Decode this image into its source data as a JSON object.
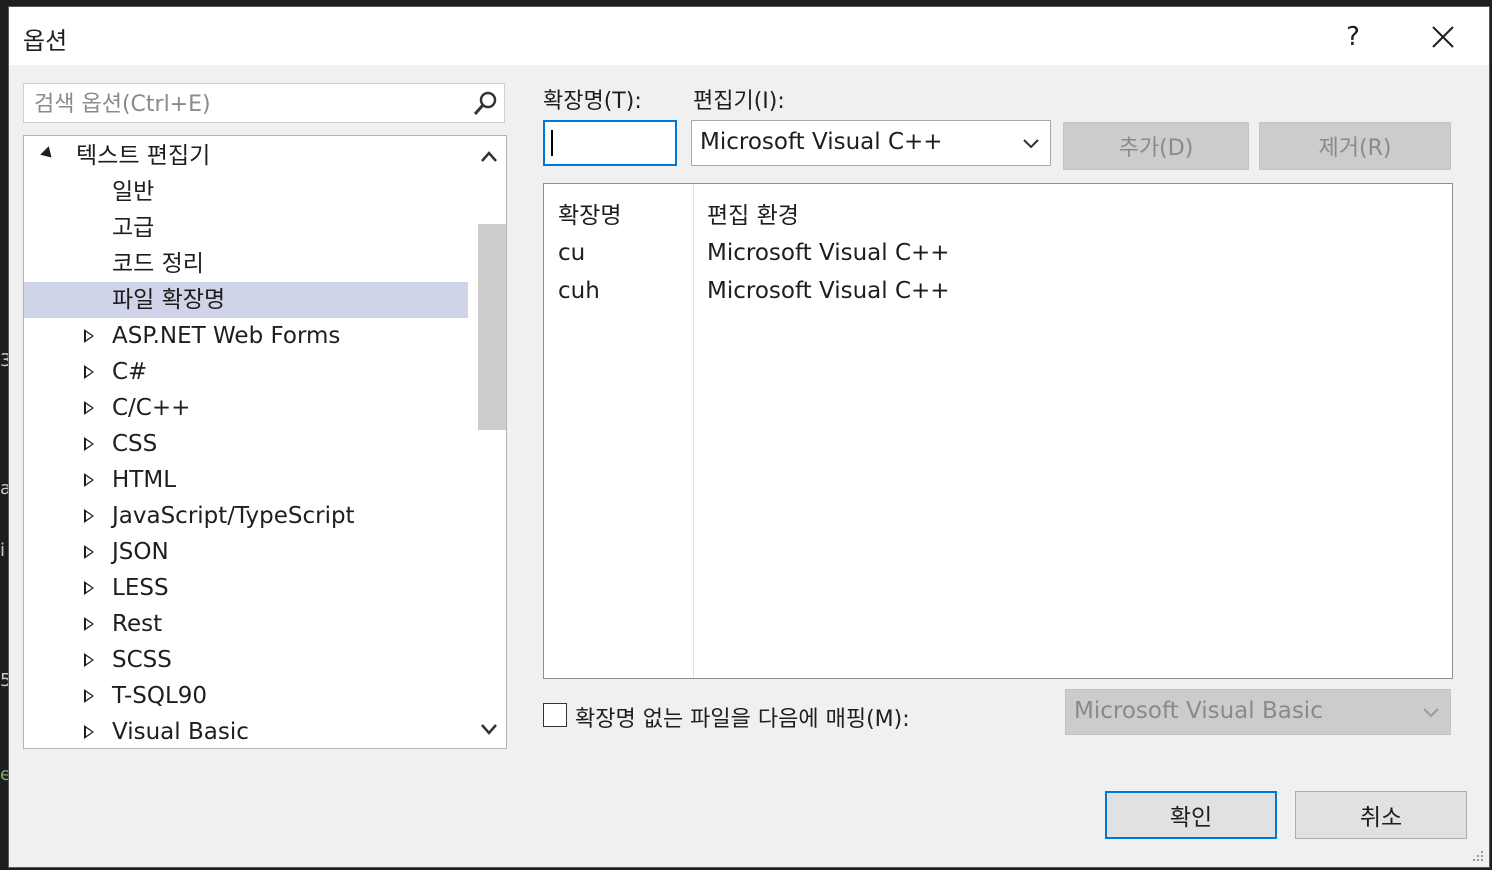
{
  "background_edge": {
    "glyphs": [
      "3",
      "a",
      "i",
      "5",
      "e"
    ]
  },
  "dialog": {
    "title": "옵션",
    "help_label": "?",
    "close_label": "✕"
  },
  "search": {
    "placeholder": "검색 옵션(Ctrl+E)"
  },
  "tree": {
    "expanded_label": "텍스트 편집기",
    "children": [
      "일반",
      "고급",
      "코드 정리",
      "파일 확장명"
    ],
    "selected": "파일 확장명",
    "collapsed_items": [
      "ASP.NET Web Forms",
      "C#",
      "C/C++",
      "CSS",
      "HTML",
      "JavaScript/TypeScript",
      "JSON",
      "LESS",
      "Rest",
      "SCSS",
      "T-SQL90",
      "Visual Basic"
    ]
  },
  "form": {
    "extension_label": "확장명(T):",
    "extension_value": "",
    "editor_label": "편집기(I):",
    "editor_value": "Microsoft Visual C++",
    "add_label": "추가(D)",
    "remove_label": "제거(R)"
  },
  "ext_table": {
    "headers": [
      "확장명",
      "편집 환경"
    ],
    "rows": [
      [
        "cu",
        "Microsoft Visual C++"
      ],
      [
        "cuh",
        "Microsoft Visual C++"
      ]
    ]
  },
  "mapping": {
    "checkbox_label": "확장명 없는 파일을 다음에 매핑(M):",
    "checked": false,
    "select_value": "Microsoft Visual Basic"
  },
  "footer": {
    "ok_label": "확인",
    "cancel_label": "취소"
  },
  "colors": {
    "accent": "#0078d7",
    "selection": "#d0d4e8",
    "dialog_bg": "#f0f0f0"
  }
}
